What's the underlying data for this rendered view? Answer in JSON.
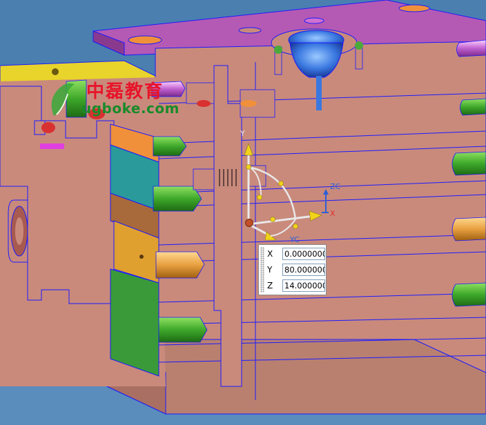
{
  "watermark": {
    "chinese_text": "中磊教育",
    "url_text": "ugboke.com"
  },
  "triad": {
    "x_label": "X",
    "y_label": "Y",
    "zc_label": "ZC",
    "yc_label": "YC",
    "x_color": "#e03030",
    "zc_color": "#2b5fd6",
    "yc_color": "#2b5fd6",
    "handle_color": "#f2d21a"
  },
  "coordinate_input": {
    "x_label": "X",
    "x_value": "0.0000000",
    "y_label": "Y",
    "y_value": "80.0000000",
    "z_label": "Z",
    "z_value": "14.0000000"
  },
  "colors": {
    "background": "#4b7fb0",
    "plate": "#c98a7c",
    "edge": "#1a1aff",
    "top_plate": "#b45ab4",
    "yellow_plate": "#e8d42a",
    "teal_plate": "#2a9a9a",
    "green_plate": "#3a9a3a",
    "orange_plate": "#e0a030"
  }
}
